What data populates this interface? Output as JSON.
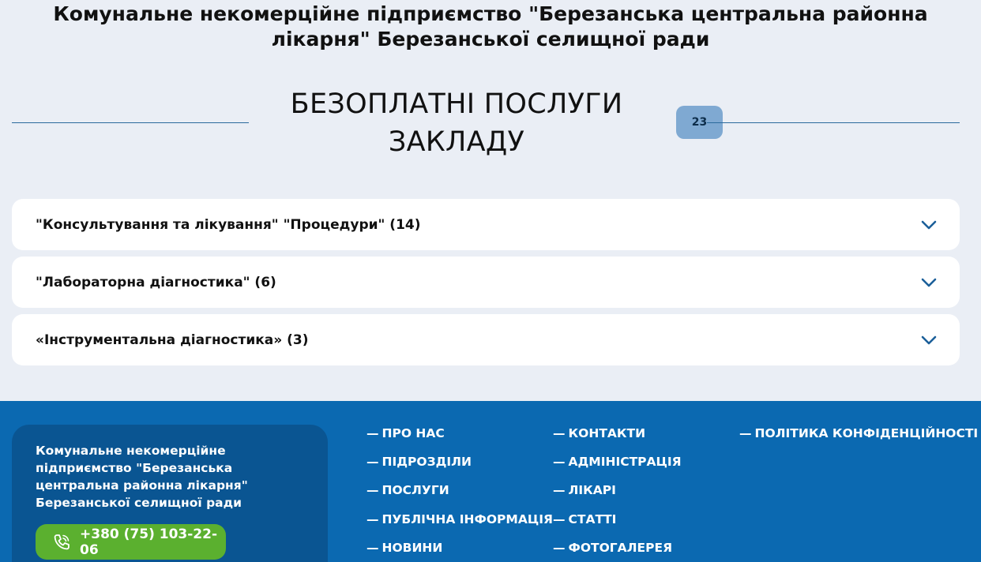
{
  "header": {
    "org_title": "Комунальне некомерційне підприємство \"Березанська центральна районна лікарня\" Березанської селищної ради"
  },
  "section": {
    "title": "БЕЗОПЛАТНІ ПОСЛУГИ ЗАКЛАДУ",
    "count": "23"
  },
  "accordion": [
    {
      "label": "\"Консультування та лікування\" \"Процедури\" (14)"
    },
    {
      "label": "\"Лабораторна діагностика\" (6)"
    },
    {
      "label": "«Інструментальна діагностика» (3)"
    }
  ],
  "footer": {
    "org_name": "Комунальне некомерційне підприємство \"Березанська центральна районна лікарня\" Березанської селищної ради",
    "phone": "+380 (75) 103-22-06",
    "dash": "—",
    "nav": {
      "col1": [
        "ПРО НАС",
        "ПІДРОЗДІЛИ",
        "ПОСЛУГИ",
        "ПУБЛІЧНА ІНФОРМАЦІЯ",
        "НОВИНИ"
      ],
      "col2": [
        "КОНТАКТИ",
        "АДМІНІСТРАЦІЯ",
        "ЛІКАРІ",
        "СТАТТІ",
        "ФОТОГАЛЕРЕЯ"
      ],
      "col3": [
        "ПОЛІТИКА КОНФІДЕНЦІЙНОСТІ"
      ]
    }
  },
  "colors": {
    "page_bg": "#eaeef5",
    "accent_line": "#2b6a9c",
    "badge_bg": "#7fa9d2",
    "footer_bg": "#0b69b1",
    "footer_card_bg": "#0a5592",
    "phone_button_bg": "#5bb02f",
    "chevron": "#1b5f99"
  },
  "icons": {
    "accordion_toggle": "chevron-down-icon",
    "phone": "phone-icon"
  }
}
